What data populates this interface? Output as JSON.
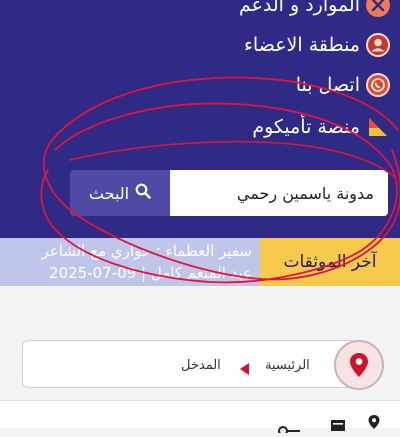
{
  "menu": {
    "items": [
      {
        "label": "الموارد و الدعم",
        "icon": "close-x-icon"
      },
      {
        "label": "منطقة الاعضاء",
        "icon": "user-icon"
      },
      {
        "label": "اتصل بنا",
        "icon": "whatsapp-icon"
      },
      {
        "label": "منصة تأميكوم",
        "icon": "flag-icon"
      }
    ]
  },
  "search": {
    "value": "مدونة ياسمين رحمي",
    "button_label": "البحث"
  },
  "ticker": {
    "label": "آخر الموثقات",
    "line1": "سفير العظماء : حواري مع الشاعر",
    "line2": "عبد المنعم كامل | 09-07-2025"
  },
  "breadcrumb": {
    "home": "الرئيسية",
    "current": "المدخل"
  },
  "colors": {
    "nav_bg": "#2e2a86",
    "search_button": "#4f4aa3",
    "ticker_bg": "#bfc6ea",
    "ticker_label_bg": "#f7c94d",
    "annotation": "#e0143c",
    "pin": "#d0112b"
  }
}
